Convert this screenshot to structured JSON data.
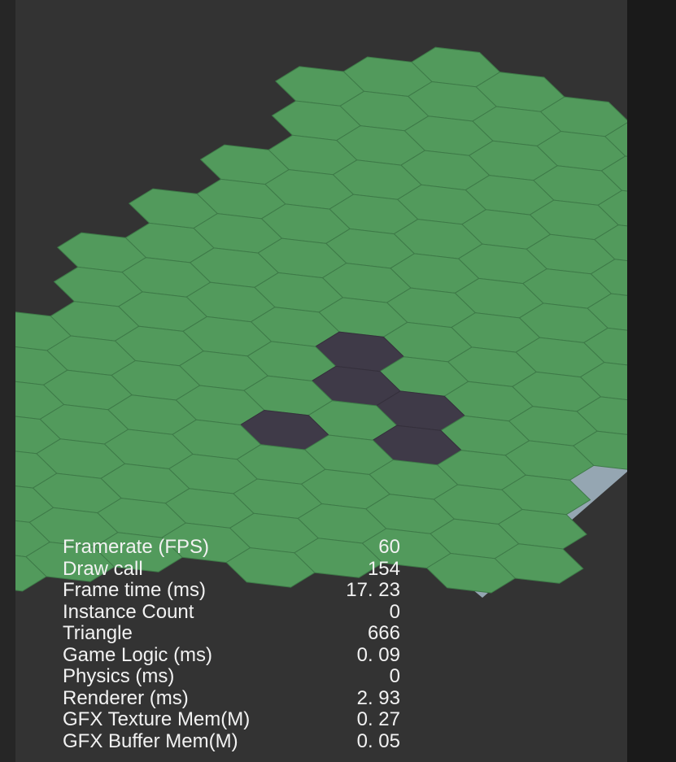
{
  "scene": {
    "colors": {
      "background": "#333333",
      "tile": "#529a5c",
      "tile_edge": "#3e7a48",
      "obstacle": "#3f3a48",
      "ground_side": "#95a6b2"
    },
    "obstacle_tiles": [
      {
        "row": 9,
        "col": 4
      },
      {
        "row": 10,
        "col": 5
      },
      {
        "row": 10,
        "col": 6
      },
      {
        "row": 11,
        "col": 6
      },
      {
        "row": 12,
        "col": 5
      }
    ]
  },
  "stats": [
    {
      "label": "Framerate (FPS)",
      "value": "60"
    },
    {
      "label": "Draw call",
      "value": "154"
    },
    {
      "label": "Frame time (ms)",
      "value": "17. 23"
    },
    {
      "label": "Instance Count",
      "value": "0"
    },
    {
      "label": "Triangle",
      "value": "666"
    },
    {
      "label": "Game Logic (ms)",
      "value": "0. 09"
    },
    {
      "label": "Physics (ms)",
      "value": "0"
    },
    {
      "label": "Renderer (ms)",
      "value": "2. 93"
    },
    {
      "label": "GFX Texture Mem(M)",
      "value": "0. 27"
    },
    {
      "label": "GFX Buffer Mem(M)",
      "value": "0. 05"
    }
  ]
}
